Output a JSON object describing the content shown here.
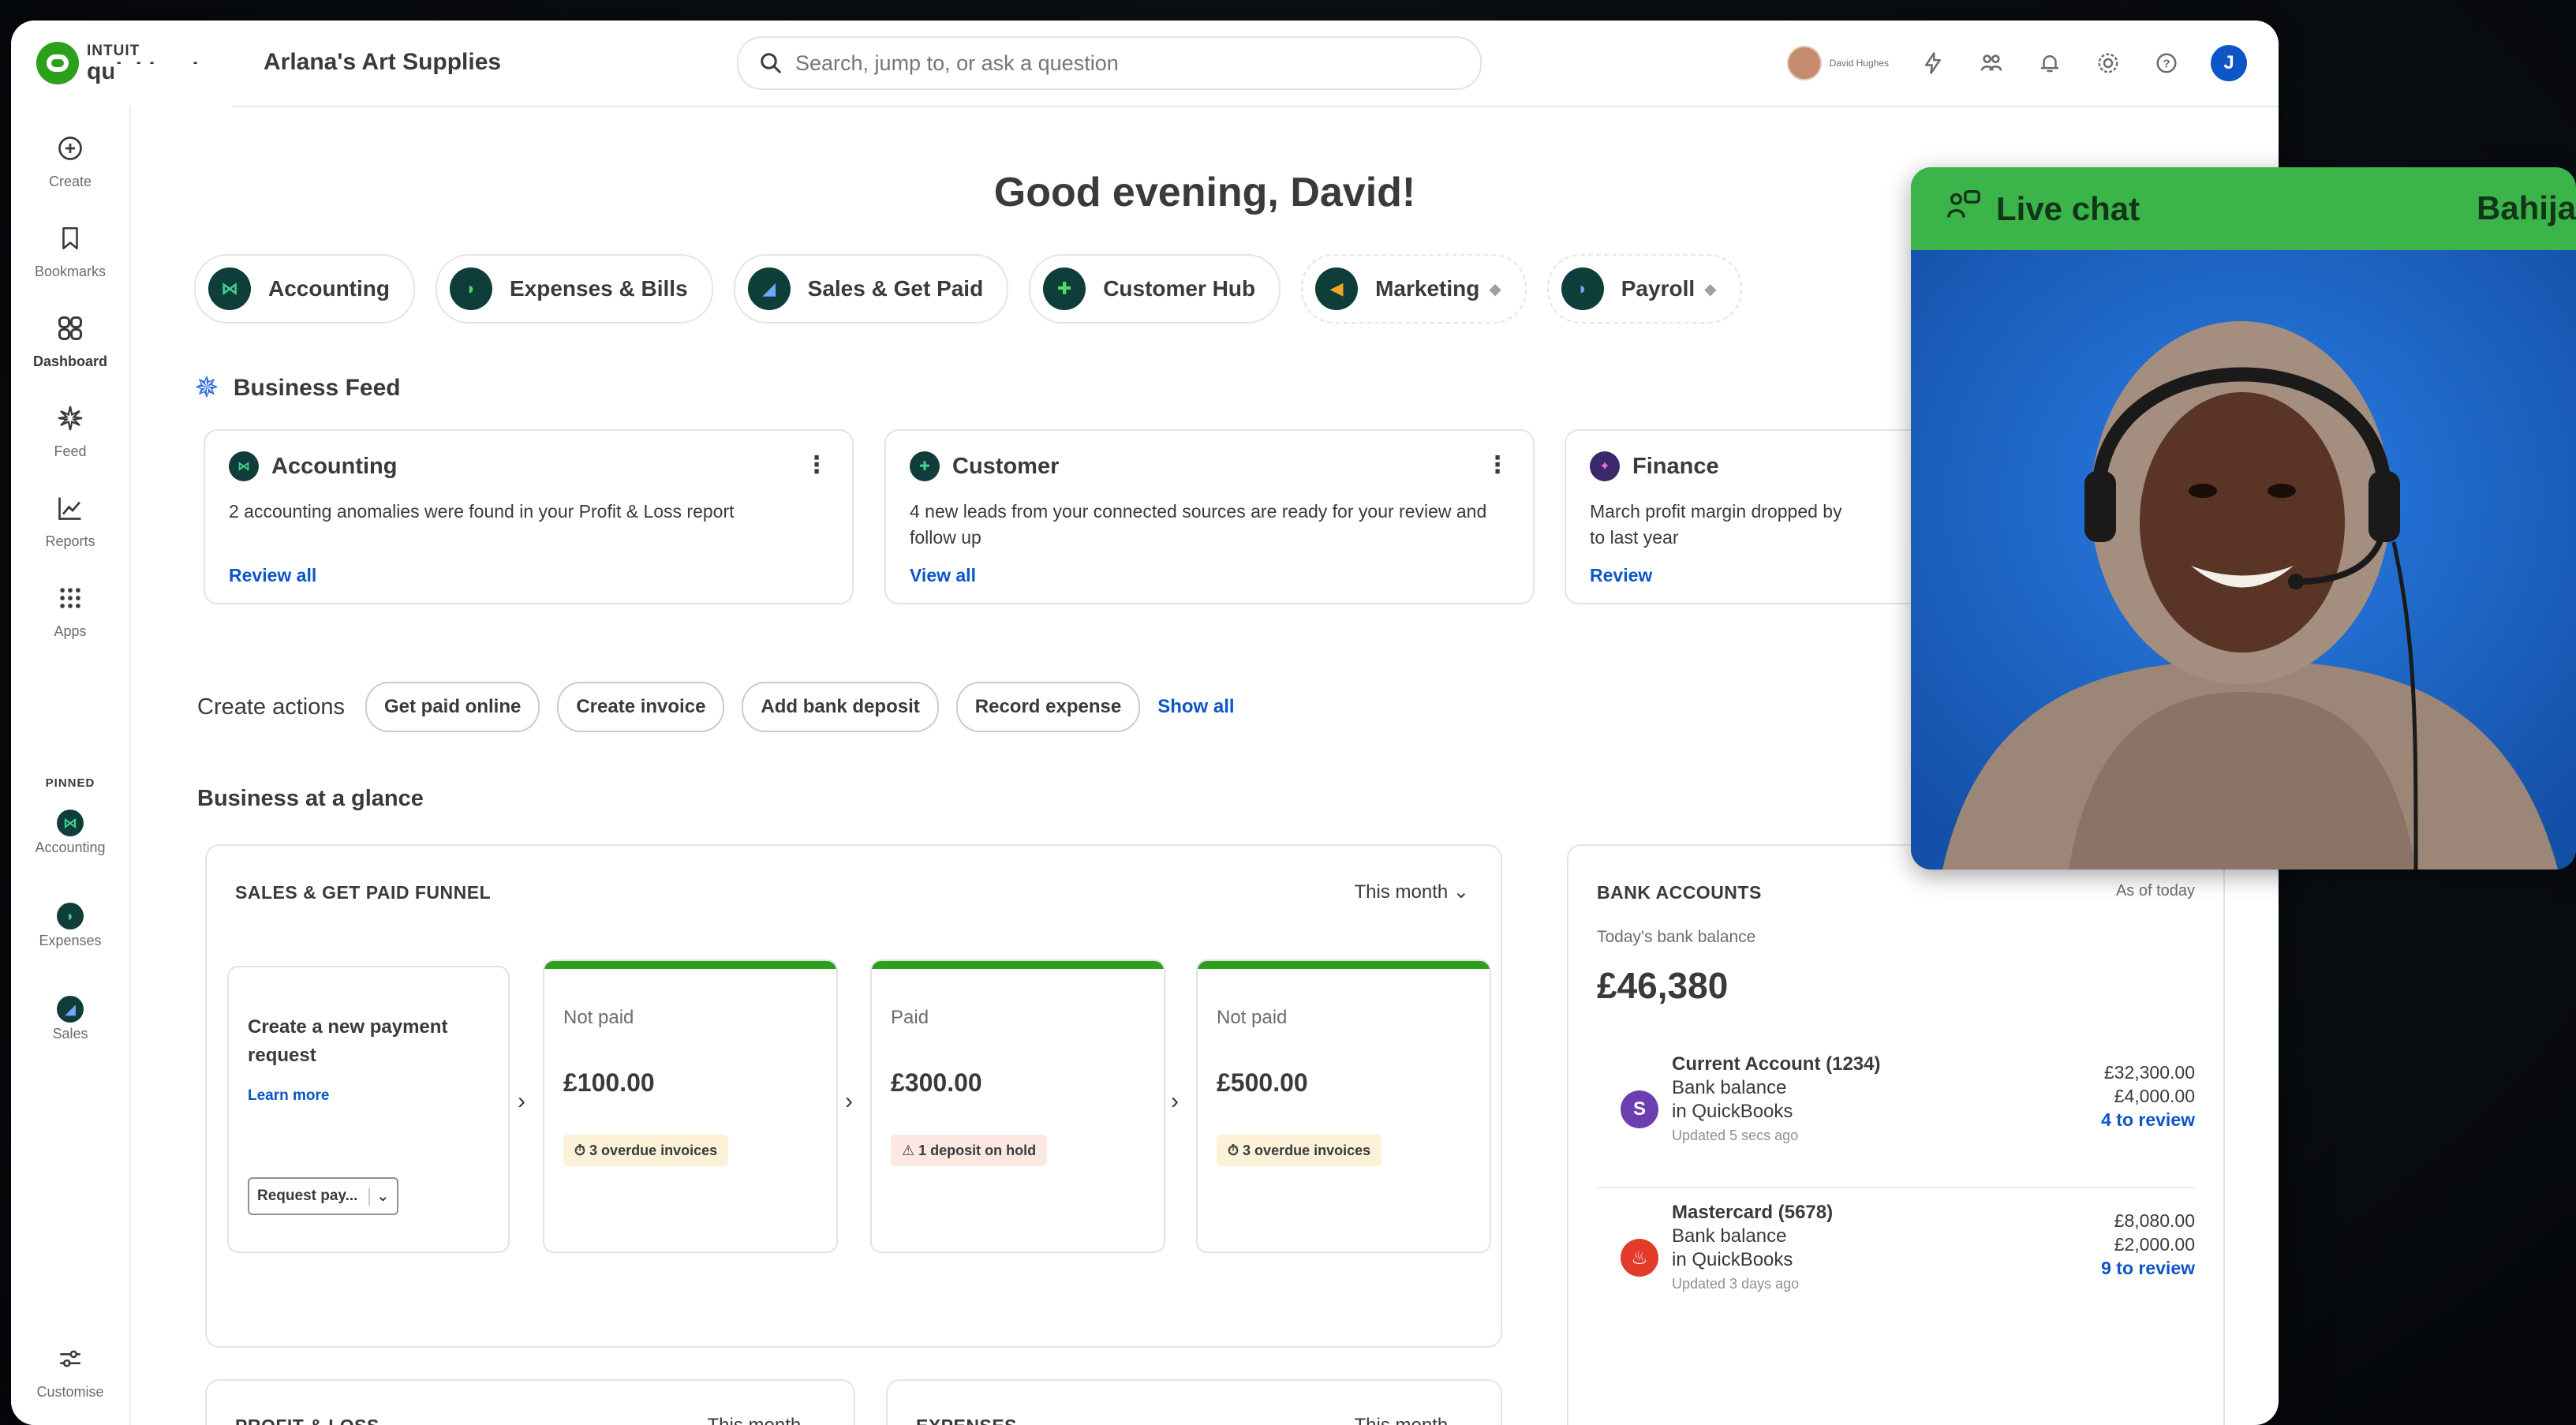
{
  "app": {
    "logo_top": "INTUIT",
    "logo_bottom": "quickbooks",
    "company": "Arlana's Art Supplies"
  },
  "search": {
    "placeholder": "Search, jump to, or ask a question"
  },
  "topbar": {
    "user_name": "David Hughes",
    "user_initial": "J"
  },
  "sidebar": {
    "items": [
      {
        "label": "Create",
        "icon": "plus-circle-icon"
      },
      {
        "label": "Bookmarks",
        "icon": "bookmark-icon"
      },
      {
        "label": "Dashboard",
        "icon": "dashboard-icon"
      },
      {
        "label": "Feed",
        "icon": "feed-icon"
      },
      {
        "label": "Reports",
        "icon": "reports-icon"
      },
      {
        "label": "Apps",
        "icon": "apps-icon"
      }
    ],
    "pinned_label": "PINNED",
    "pinned": [
      {
        "label": "Accounting"
      },
      {
        "label": "Expenses"
      },
      {
        "label": "Sales"
      }
    ],
    "customise": "Customise"
  },
  "greeting": "Good evening, David!",
  "pills": [
    {
      "label": "Accounting",
      "color": "#1a7f64"
    },
    {
      "label": "Expenses & Bills",
      "color": "#2ca01c"
    },
    {
      "label": "Sales & Get Paid",
      "color": "#0d56c7"
    },
    {
      "label": "Customer Hub",
      "color": "#2ca01c"
    },
    {
      "label": "Marketing",
      "color": "#f5a623"
    },
    {
      "label": "Payroll",
      "color": "#0d56c7"
    }
  ],
  "business_feed": {
    "title": "Business Feed",
    "cards": [
      {
        "title": "Accounting",
        "body": "2 accounting anomalies were found in your Profit & Loss report",
        "link": "Review all"
      },
      {
        "title": "Customer",
        "body": "4 new leads from your connected sources are ready for your review and follow up",
        "link": "View all"
      },
      {
        "title": "Finance",
        "body": "March profit margin dropped by",
        "body2": "to last year",
        "link": "Review"
      }
    ]
  },
  "create_actions": {
    "label": "Create actions",
    "chips": [
      "Get paid online",
      "Create invoice",
      "Add bank deposit",
      "Record expense"
    ],
    "show_all": "Show all"
  },
  "glance": {
    "title": "Business at a glance"
  },
  "funnel": {
    "title": "SALES & GET PAID FUNNEL",
    "period": "This month",
    "intro": {
      "title": "Create a new payment request",
      "link": "Learn more",
      "select_value": "Request pay..."
    },
    "stages": [
      {
        "state": "Not paid",
        "amount": "£100.00",
        "badge": "3 overdue invoices",
        "badge_type": "info"
      },
      {
        "state": "Paid",
        "amount": "£300.00",
        "badge": "1 deposit on hold",
        "badge_type": "warn"
      },
      {
        "state": "Not paid",
        "amount": "£500.00",
        "badge": "3 overdue invoices",
        "badge_type": "info"
      }
    ]
  },
  "bank": {
    "title": "BANK ACCOUNTS",
    "as_of": "As of today",
    "subtitle": "Today's bank balance",
    "balance": "£46,380",
    "accounts": [
      {
        "name": "Current Account (1234)",
        "l1": "Bank balance",
        "l2": "in QuickBooks",
        "updated": "Updated 5 secs ago",
        "v1": "£32,300.00",
        "v2": "£4,000.00",
        "review": "4 to review",
        "color": "#6b3fb0"
      },
      {
        "name": "Mastercard (5678)",
        "l1": "Bank balance",
        "l2": "in QuickBooks",
        "updated": "Updated 3 days ago",
        "v1": "£8,080.00",
        "v2": "£2,000.00",
        "review": "9 to review",
        "color": "#e23b2a"
      }
    ]
  },
  "bottom": {
    "pl_title": "PROFIT & LOSS",
    "pl_period": "This month",
    "exp_title": "EXPENSES",
    "exp_period": "This month"
  },
  "chat": {
    "title": "Live chat",
    "agent": "Bahija"
  }
}
